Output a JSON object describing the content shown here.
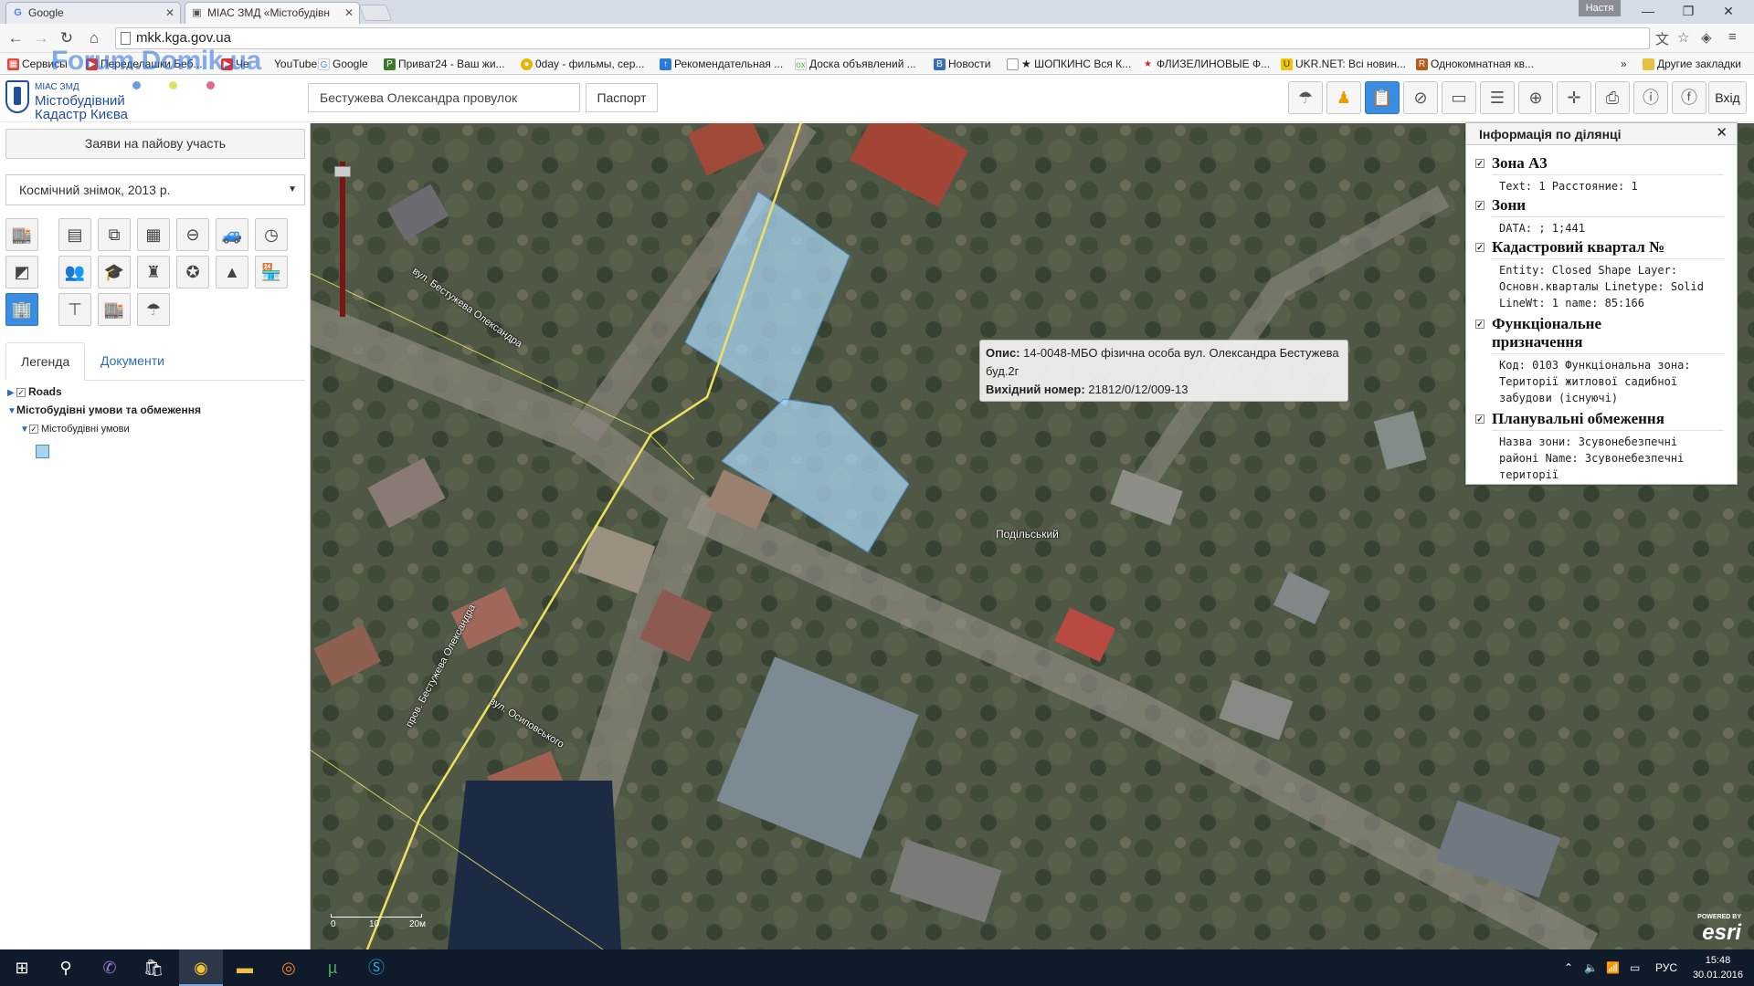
{
  "browser": {
    "tabs": [
      {
        "title": "Google",
        "icon": "G"
      },
      {
        "title": "МІАС ЗМД «Містобудівн",
        "icon": "▣"
      }
    ],
    "user": "Настя",
    "url": "mkk.kga.gov.ua",
    "bookmarks": [
      "Сервисы",
      "Переделашки Беб...",
      "Че",
      "YouTube",
      "Google",
      "Приват24 - Ваш жи...",
      "0day - фильмы, сер...",
      "Рекомендательная ...",
      "Доска объявлений ...",
      "Новости",
      "★ ШОПКИНС Вся К...",
      "ФЛИЗЕЛИНОВЫЕ Ф...",
      "UKR.NET: Всі новин...",
      "Однокомнатная кв..."
    ],
    "other_bookmarks": "Другие закладки",
    "watermark": "Forum.Domik.ua"
  },
  "app": {
    "logo_small": "МІАС ЗМД",
    "logo_line1": "Містобудівний",
    "logo_line2": "Кадастр Києва",
    "search_value": "Бестужева Олександра провулок",
    "passport_label": "Паспорт",
    "login_label": "Вхід",
    "dot_colors": [
      "#6a9de0",
      "#e0e06a",
      "#e06a8a"
    ],
    "toolbar_icons": [
      "parasol-icon",
      "person-icon",
      "clipboard-icon",
      "compass-icon",
      "ruler-icon",
      "layers-icon",
      "globe-icon",
      "extent-icon",
      "print-icon",
      "info-icon",
      "facebook-icon"
    ]
  },
  "sidebar": {
    "apply_label": "Заяви на пайову участь",
    "basemap_value": "Космічний знімок, 2013 р.",
    "layer_icons": [
      [
        "store-icon",
        "document-icon",
        "puzzle-icon",
        "grid-icon",
        "sign-icon",
        "car-icon",
        "clock-icon"
      ],
      [
        "map-icon",
        "people-icon",
        "graduation-icon",
        "monument-icon",
        "police-icon",
        "tent-icon",
        "shop-icon"
      ],
      [
        "building-icon",
        "billboard-icon",
        "market-icon",
        "parasol-icon"
      ]
    ],
    "tab_legend": "Легенда",
    "tab_docs": "Документи",
    "legend_roads": "Roads",
    "legend_group": "Містобудівні умови та обмеження",
    "legend_sub": "Містобудівні умови"
  },
  "map": {
    "popup_label1": "Опис:",
    "popup_value1": "14-0048-МБО фізична особа вул. Олександра Бестужева буд.2г",
    "popup_label2": "Вихідний номер:",
    "popup_value2": "21812/0/12/009-13",
    "district": "Подільський",
    "road1": "вул. Бестужева Олександра",
    "road2": "пров. Бестужева Олександра",
    "road3": "вул. Осиповського",
    "scale_labels": [
      "0",
      "10",
      "20м"
    ],
    "esri_powered": "POWERED BY",
    "esri": "esri"
  },
  "info": {
    "title": "Інформація по ділянці",
    "sections": [
      {
        "title": "Зона А3",
        "body": "Text: 1 Расстояние: 1"
      },
      {
        "title": "Зони",
        "body": "DATA: ; 1;441"
      },
      {
        "title": "Кадастровий квартал №",
        "body": "Entity: Closed Shape Layer:\nОсновн.кварталы Linetype: Solid\nLineWt: 1 name: 85:166"
      },
      {
        "title": "Функціональне\nпризначення",
        "body": "Код: 0103 Функціональна зона:\nТериторії житлової садибної\nзабудови (існуючі)"
      },
      {
        "title": "Планувальні обмеження",
        "body": "Назва зони: Зсувонебезпечні\nрайоні Name: Зсувонебезпечні\nтериторії"
      }
    ]
  },
  "taskbar": {
    "lang": "РУС",
    "time": "15:48",
    "date": "30.01.2016"
  }
}
